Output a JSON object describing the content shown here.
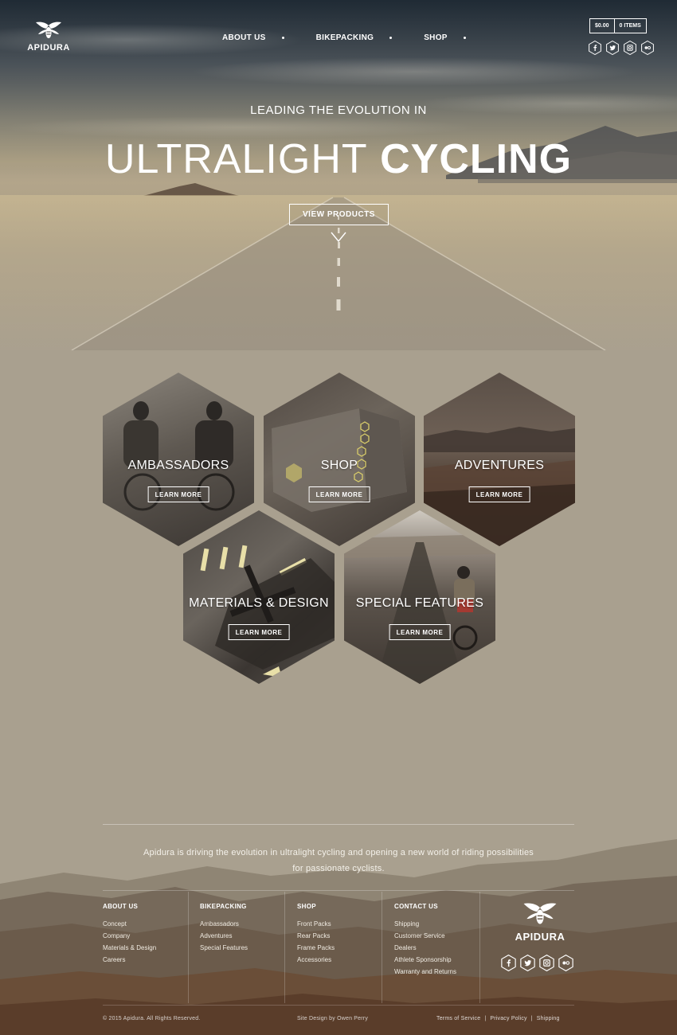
{
  "brand": {
    "name": "APIDURA",
    "logo_icon": "bee-icon"
  },
  "nav": {
    "items": [
      {
        "label": "ABOUT US"
      },
      {
        "label": "BIKEPACKING"
      },
      {
        "label": "SHOP"
      }
    ]
  },
  "cart": {
    "total": "$0.00",
    "items": "0 ITEMS"
  },
  "social": [
    "facebook-icon",
    "twitter-icon",
    "instagram-icon",
    "flickr-icon"
  ],
  "hero": {
    "subtitle": "LEADING THE EVOLUTION IN",
    "title_light": "ULTRALIGHT",
    "title_bold": "CYCLING",
    "cta": "VIEW PRODUCTS"
  },
  "tiles": [
    {
      "label": "AMBASSADORS",
      "button": "LEARN MORE"
    },
    {
      "label": "SHOP",
      "button": "LEARN MORE"
    },
    {
      "label": "ADVENTURES",
      "button": "LEARN MORE"
    },
    {
      "label": "MATERIALS & DESIGN",
      "button": "LEARN MORE"
    },
    {
      "label": "SPECIAL FEATURES",
      "button": "LEARN MORE"
    }
  ],
  "footer": {
    "tagline": "Apidura is driving the evolution in ultralight cycling and opening a new world of riding possibilities for passionate cyclists.",
    "columns": [
      {
        "title": "ABOUT US",
        "links": [
          "Concept",
          "Company",
          "Materials & Design",
          "Careers"
        ]
      },
      {
        "title": "BIKEPACKING",
        "links": [
          "Ambassadors",
          "Adventures",
          "Special Features"
        ]
      },
      {
        "title": "SHOP",
        "links": [
          "Front Packs",
          "Rear Packs",
          "Frame Packs",
          "Accessories"
        ]
      },
      {
        "title": "CONTACT US",
        "links": [
          "Shipping",
          "Customer Service",
          "Dealers",
          "Athlete Sponsorship",
          "Warranty and Returns"
        ]
      }
    ],
    "copyright": "© 2015 Apidura. All Rights Reserved.",
    "credit": "Site Design by Owen Perry",
    "legal": [
      "Terms of Service",
      "Privacy Policy",
      "Shipping"
    ],
    "legal_separator": "|"
  },
  "colors": {
    "background": "#a9a08f",
    "text": "#ffffff"
  }
}
